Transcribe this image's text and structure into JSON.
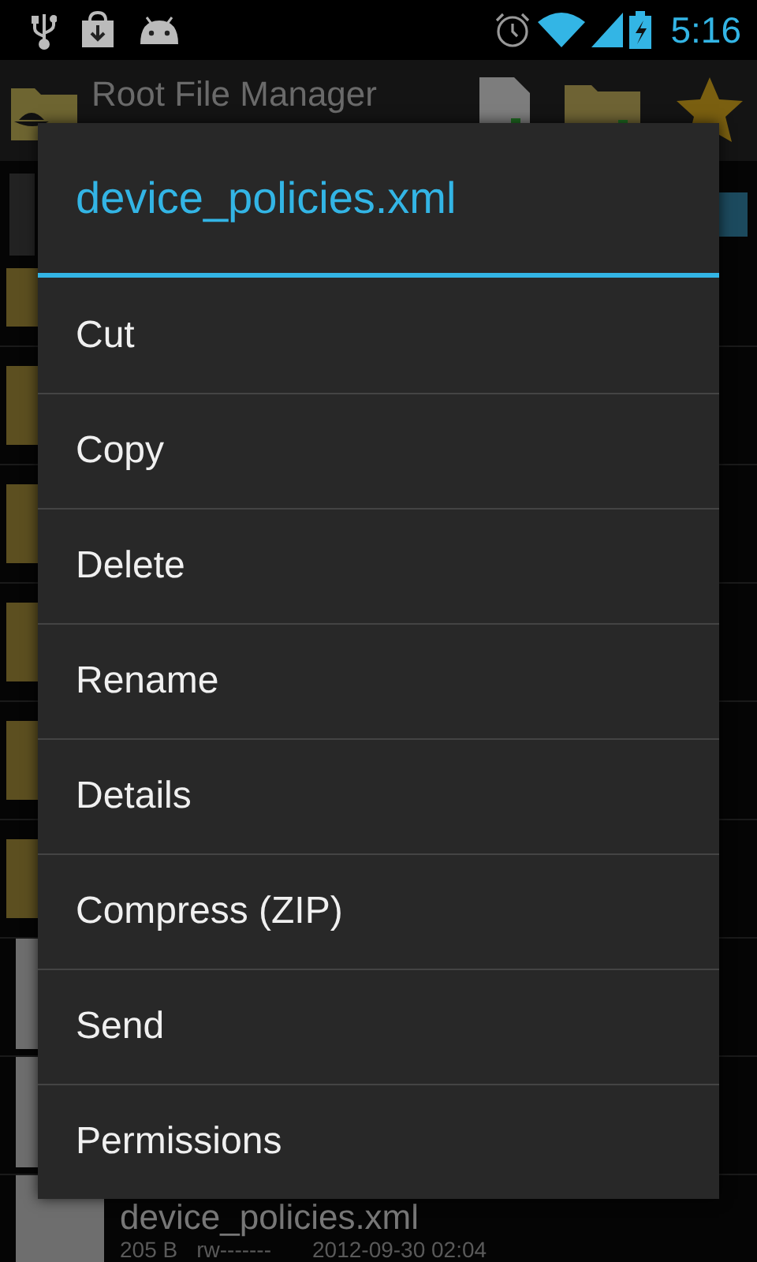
{
  "status_bar": {
    "time": "5:16"
  },
  "app_bar": {
    "title": "Root File Manager"
  },
  "file_list": {
    "rows": [
      {
        "kind": "folder"
      },
      {
        "kind": "folder"
      },
      {
        "kind": "folder"
      },
      {
        "kind": "folder"
      },
      {
        "kind": "folder"
      },
      {
        "kind": "folder"
      },
      {
        "kind": "file"
      },
      {
        "kind": "file"
      },
      {
        "kind": "file",
        "name": "device_policies.xml",
        "size": "205 B",
        "permissions": "rw-------",
        "modified": "2012-09-30 02:04"
      }
    ]
  },
  "dialog": {
    "title": "device_policies.xml",
    "items": [
      "Cut",
      "Copy",
      "Delete",
      "Rename",
      "Details",
      "Compress (ZIP)",
      "Send",
      "Permissions"
    ]
  }
}
